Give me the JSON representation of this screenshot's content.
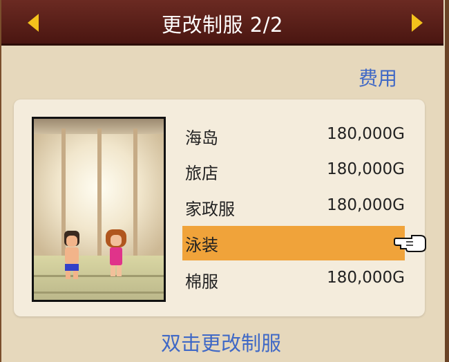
{
  "header": {
    "title": "更改制服 2/2"
  },
  "cost_label": "费用",
  "uniforms": [
    {
      "name": "海岛",
      "price": "180,000G",
      "selected": false
    },
    {
      "name": "旅店",
      "price": "180,000G",
      "selected": false
    },
    {
      "name": "家政服",
      "price": "180,000G",
      "selected": false
    },
    {
      "name": "泳装",
      "price": "",
      "selected": true
    },
    {
      "name": "棉服",
      "price": "180,000G",
      "selected": false
    }
  ],
  "hint": "双击更改制服",
  "colors": {
    "header": "#5a1f19",
    "arrow": "#f3c21c",
    "accent_text": "#3f68c6",
    "selected_row": "#f0a33a",
    "background": "#e6d8bc"
  },
  "icons": {
    "prev": "triangle-left-icon",
    "next": "triangle-right-icon",
    "pointer": "pointing-hand-icon"
  }
}
